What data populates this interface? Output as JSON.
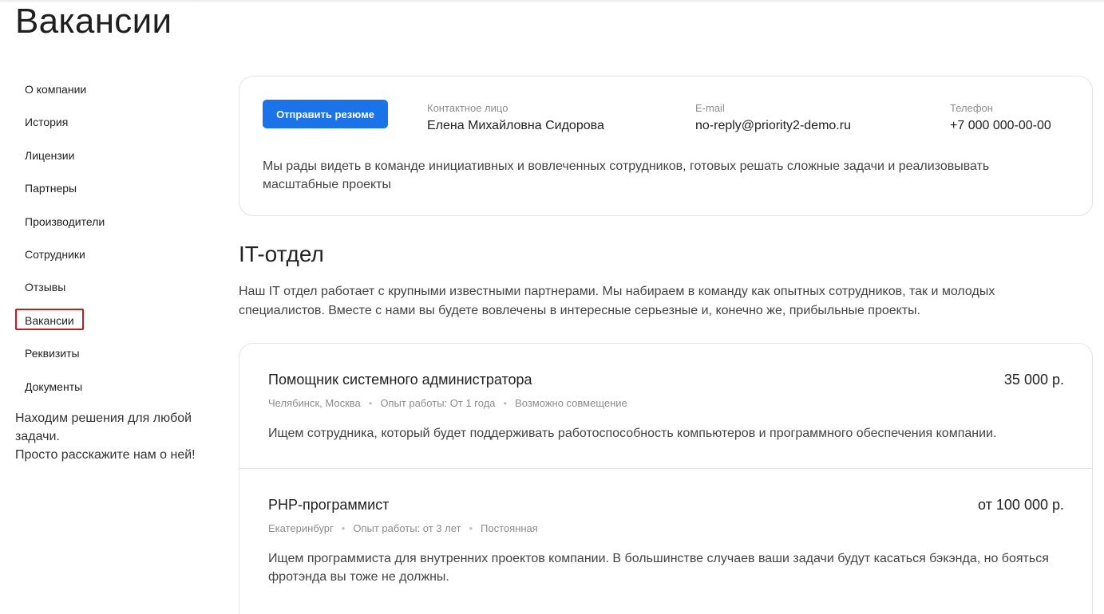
{
  "page": {
    "title": "Вакансии"
  },
  "sidebar": {
    "items": [
      {
        "label": "О компании"
      },
      {
        "label": "История"
      },
      {
        "label": "Лицензии"
      },
      {
        "label": "Партнеры"
      },
      {
        "label": "Производители"
      },
      {
        "label": "Сотрудники"
      },
      {
        "label": "Отзывы"
      },
      {
        "label": "Вакансии",
        "active": true
      },
      {
        "label": "Реквизиты"
      },
      {
        "label": "Документы"
      }
    ],
    "note_line1": "Находим решения для любой задачи.",
    "note_line2": "Просто расскажите нам о ней!",
    "active_border_color": "#c71a1a"
  },
  "contact_card": {
    "button_label": "Отправить резюме",
    "contact_person_label": "Контактное лицо",
    "contact_person_value": "Елена Михайловна Сидорова",
    "email_label": "E-mail",
    "email_value": "no-reply@priority2-demo.ru",
    "phone_label": "Телефон",
    "phone_value": "+7 000 000-00-00",
    "text": "Мы рады видеть в команде инициативных и вовлеченных сотрудников, готовых решать сложные задачи и реализовывать масштабные проекты",
    "button_color": "#1a73e8"
  },
  "section": {
    "title": "IT-отдел",
    "description": "Наш IT отдел работает с крупными известными партнерами. Мы набираем в команду как опытных сотрудников, так и молодых специалистов. Вместе с нами вы будете вовлечены в интересные серьезные и, конечно же, прибыльные проекты."
  },
  "vacancies": [
    {
      "title": "Помощник системного администратора",
      "salary": "35 000 р.",
      "city": "Челябинск, Москва",
      "experience": "Опыт работы: От 1 года",
      "schedule": "Возможно совмещение",
      "description": "Ищем сотрудника, который будет поддерживать работоспособность компьютеров и программного обеспечения компании."
    },
    {
      "title": "PHP-программист",
      "salary": "от 100 000 р.",
      "city": "Екатеринбург",
      "experience": "Опыт работы: от 3 лет",
      "schedule": "Постоянная",
      "description": "Ищем программиста для внутренних проектов компании. В большинстве случаев ваши задачи будут касаться бэкэнда, но бояться фротэнда вы тоже не должны."
    }
  ]
}
